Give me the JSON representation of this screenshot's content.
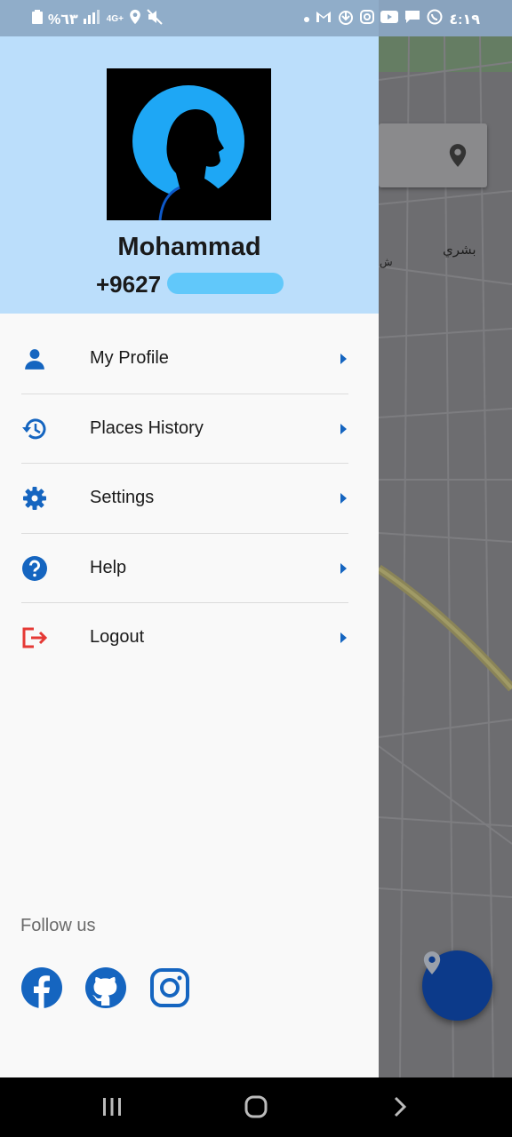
{
  "status_bar": {
    "left_text": "%٦٣",
    "network": "4G+",
    "time": "٤:١٩"
  },
  "drawer": {
    "user": {
      "name": "Mohammad",
      "phone": "+9627"
    },
    "menu": [
      {
        "label": "My Profile",
        "icon": "person-icon"
      },
      {
        "label": "Places History",
        "icon": "history-icon"
      },
      {
        "label": "Settings",
        "icon": "gear-icon"
      },
      {
        "label": "Help",
        "icon": "help-icon"
      },
      {
        "label": "Logout",
        "icon": "logout-icon"
      }
    ],
    "follow_label": "Follow us",
    "socials": [
      "facebook-icon",
      "github-icon",
      "instagram-icon"
    ]
  },
  "map": {
    "labels": [
      "بشري",
      "ش"
    ]
  },
  "colors": {
    "header_bg": "#bbdefb",
    "accent": "#1565c0",
    "logout": "#e53935",
    "fab": "#0c3a8a"
  }
}
